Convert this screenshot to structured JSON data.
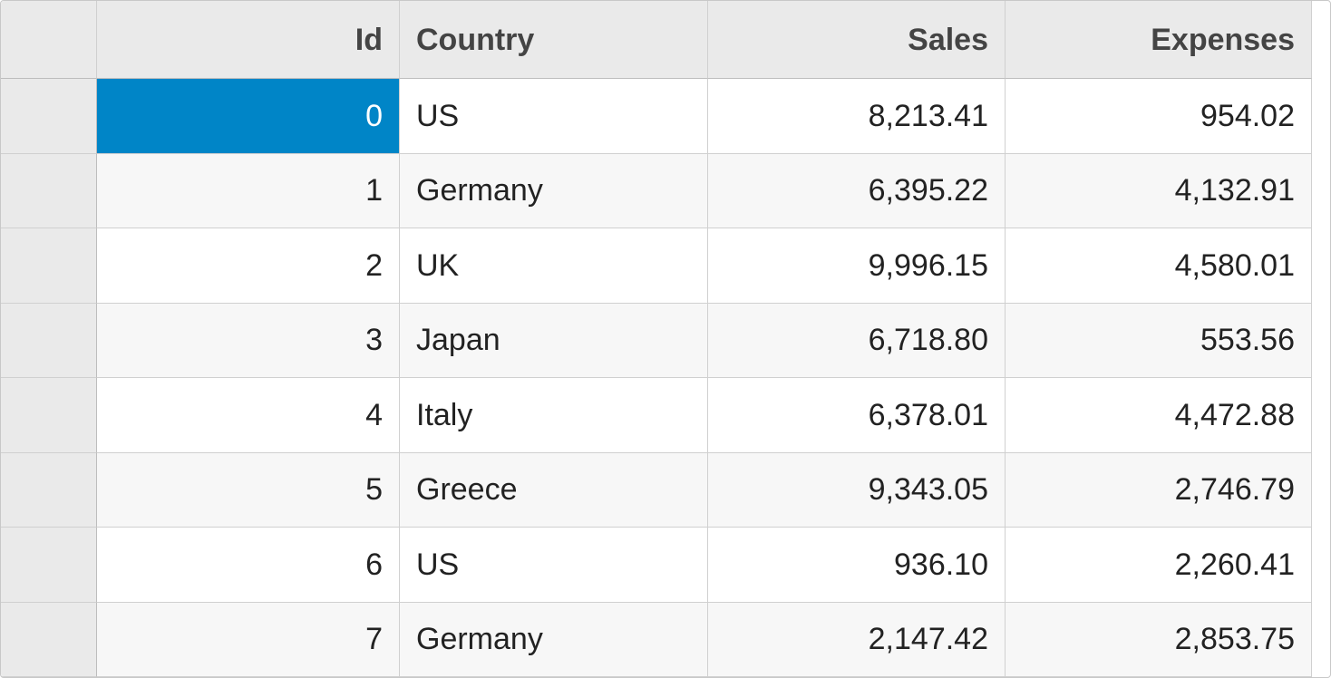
{
  "grid": {
    "columns": [
      {
        "key": "id",
        "label": "Id",
        "align": "right"
      },
      {
        "key": "country",
        "label": "Country",
        "align": "left"
      },
      {
        "key": "sales",
        "label": "Sales",
        "align": "right"
      },
      {
        "key": "expenses",
        "label": "Expenses",
        "align": "right"
      }
    ],
    "rows": [
      {
        "id": "0",
        "country": "US",
        "sales": "8,213.41",
        "expenses": "954.02"
      },
      {
        "id": "1",
        "country": "Germany",
        "sales": "6,395.22",
        "expenses": "4,132.91"
      },
      {
        "id": "2",
        "country": "UK",
        "sales": "9,996.15",
        "expenses": "4,580.01"
      },
      {
        "id": "3",
        "country": "Japan",
        "sales": "6,718.80",
        "expenses": "553.56"
      },
      {
        "id": "4",
        "country": "Italy",
        "sales": "6,378.01",
        "expenses": "4,472.88"
      },
      {
        "id": "5",
        "country": "Greece",
        "sales": "9,343.05",
        "expenses": "2,746.79"
      },
      {
        "id": "6",
        "country": "US",
        "sales": "936.10",
        "expenses": "2,260.41"
      },
      {
        "id": "7",
        "country": "Germany",
        "sales": "2,147.42",
        "expenses": "2,853.75"
      }
    ],
    "selected": {
      "row": 0,
      "column": "id"
    }
  }
}
